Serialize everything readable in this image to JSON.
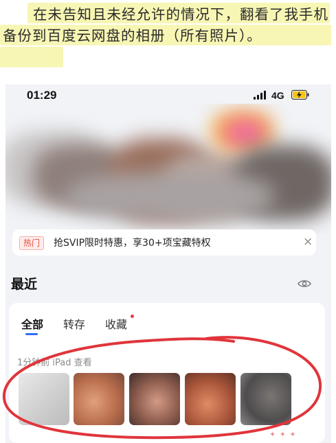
{
  "caption": {
    "text": "在未告知且未经允许的情况下，翻看了我手机备份到百度云网盘的相册（所有照片）。"
  },
  "status_bar": {
    "time": "01:29",
    "network": "4G"
  },
  "promo": {
    "badge": "热门",
    "text": "抢SVIP限时特惠，享30+项宝藏特权",
    "close": "×"
  },
  "recent": {
    "title": "最近",
    "tabs": [
      "全部",
      "转存",
      "收藏"
    ],
    "active_tab": "全部",
    "meta": "1分钟前 iPad 查看",
    "thumbnails": [
      {
        "icon": "photo-thumbnail"
      },
      {
        "icon": "photo-thumbnail"
      },
      {
        "icon": "photo-thumbnail"
      },
      {
        "icon": "photo-thumbnail"
      },
      {
        "icon": "photo-thumbnail"
      }
    ]
  },
  "colors": {
    "highlight": "#f7f6b0",
    "accent_blue": "#2f6cf6",
    "annotation_red": "#e0353b",
    "hot_red": "#e24c3d",
    "battery_yellow": "#f5c518"
  }
}
